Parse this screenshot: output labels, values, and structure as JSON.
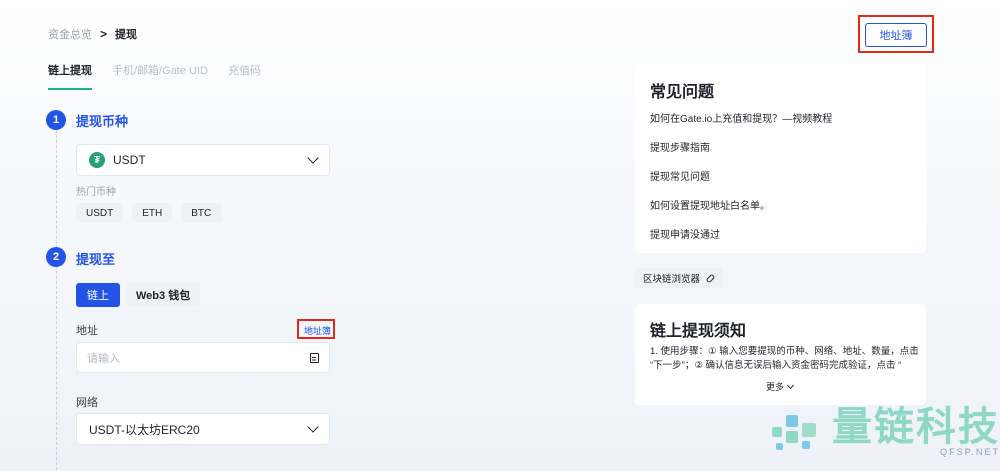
{
  "breadcrumb": {
    "root": "资金总览",
    "separator": ">",
    "current": "提现"
  },
  "header": {
    "address_book_button": "地址簿"
  },
  "tabs": [
    {
      "label": "链上提现",
      "active": true
    },
    {
      "label": "手机/邮箱/Gate UID",
      "active": false
    },
    {
      "label": "充值码",
      "active": false
    }
  ],
  "step1": {
    "number": "1",
    "title": "提现币种",
    "selected_coin": "USDT",
    "coin_icon_text": "₮",
    "hot_label": "热门币种",
    "hot_coins": [
      "USDT",
      "ETH",
      "BTC"
    ]
  },
  "step2": {
    "number": "2",
    "title": "提现至",
    "options": [
      "链上",
      "Web3 钱包"
    ],
    "address_label": "地址",
    "address_book_link": "地址簿",
    "address_placeholder": "请输入",
    "network_label": "网络",
    "network_value": "USDT-以太坊ERC20"
  },
  "faq": {
    "title": "常见问题",
    "items": [
      "如何在Gate.io上充值和提现？—视频教程",
      "提现步骤指南",
      "提现常见问题",
      "如何设置提现地址白名单。",
      "提现申请没通过"
    ]
  },
  "explorer_button": "区块链浏览器",
  "notice": {
    "title": "链上提现须知",
    "line1": "1.  使用步骤：① 输入您要提现的币种、网络、地址、数量，点击",
    "line2": "“下一步”；② 确认信息无误后输入资金密码完成验证，点击 “",
    "more": "更多"
  },
  "watermark": {
    "text": "量链科技",
    "sub": "QFSP.NET"
  },
  "colors": {
    "accent": "#2354e6",
    "tab_underline": "#21b384",
    "highlight_box": "#e0281b",
    "usdt": "#26a17b"
  }
}
